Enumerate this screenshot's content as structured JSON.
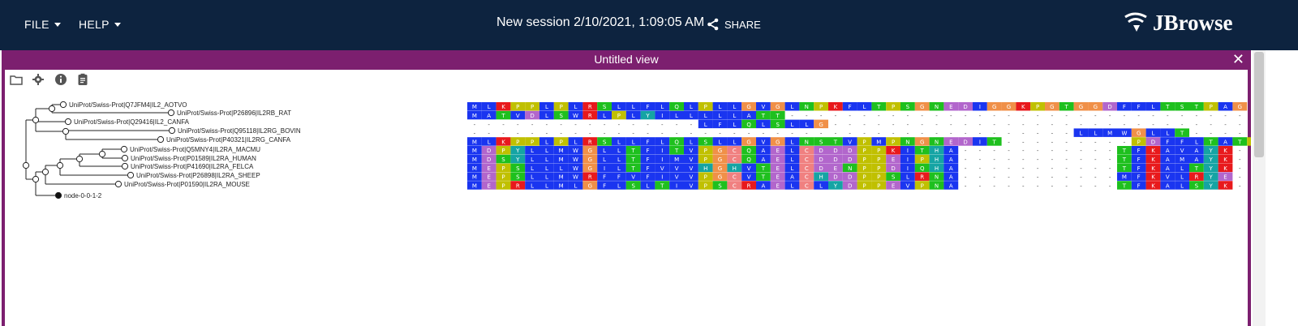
{
  "app": {
    "menus": [
      {
        "label": "FILE"
      },
      {
        "label": "HELP"
      }
    ],
    "session_title": "New session 2/10/2021, 1:09:05 AM",
    "share_label": "SHARE",
    "logo_text": "JBrowse"
  },
  "view": {
    "title": "Untitled view",
    "close_glyph": "✕",
    "toolbar_icons": [
      "folder-icon",
      "gear-icon",
      "info-icon",
      "clipboard-icon"
    ]
  },
  "tree": {
    "leaves": [
      "UniProt/Swiss-Prot|Q7JFM4|IL2_AOTVO",
      "UniProt/Swiss-Prot|P26896|IL2RB_RAT",
      "UniProt/Swiss-Prot|Q29416|IL2_CANFA",
      "UniProt/Swiss-Prot|Q95118|IL2RG_BOVIN",
      "UniProt/Swiss-Prot|P40321|IL2RG_CANFA",
      "UniProt/Swiss-Prot|Q5MNY4|IL2RA_MACMU",
      "UniProt/Swiss-Prot|P01589|IL2RA_HUMAN",
      "UniProt/Swiss-Prot|P41690|IL2RA_FELCA",
      "UniProt/Swiss-Prot|P26898|IL2RA_SHEEP",
      "UniProt/Swiss-Prot|P01590|IL2RA_MOUSE",
      "node-0-0-1-2"
    ]
  },
  "msa": {
    "rows": [
      "MLKPPLPLRSLLFLQLPLLGVGLNPKFLTPSGNEDIGGKPGTGGDFFLTSTPAG",
      "MATVDLSWRLPLYILLLLLATT--------------------------------",
      "----------------LFLQLSLLG-----------------------------",
      "------------------------------------------LLMWGLLT----",
      "MLKPPLPLRSLLFLQLSLLGVGLNSTVPMPNGNEDIT---------PDFFLTATPS",
      "MDPYLLMWGLLTFITVPGCQAELCDDDPPKITHA-----------TFKAVAYK-",
      "MDSYLLMWGLLTFIMVPGCQAELCDDDPPEIPHA-----------TFKAMAYK-",
      "MEPSLLLWGILTFVVVHGHVTELCDENPPDIQHA-----------TFKALTYK-",
      "MEPSLLMWRFFVFIVVPGCVTEACHDDPPSLRNA-----------MFKVLRYE-",
      "MEPRLLMLGFLSLTIVPSCRAELCLYDPPEVPNA-----------TFKALSYK-"
    ],
    "colors": {
      "hydrophobic": "#1a35f0",
      "positive": "#e8191c",
      "negative": "#b266cc",
      "polar": "#1ec01e",
      "cysteine": "#f08080",
      "glycine": "#f09048",
      "proline": "#c0c000",
      "aromatic": "#15a4a4"
    }
  }
}
